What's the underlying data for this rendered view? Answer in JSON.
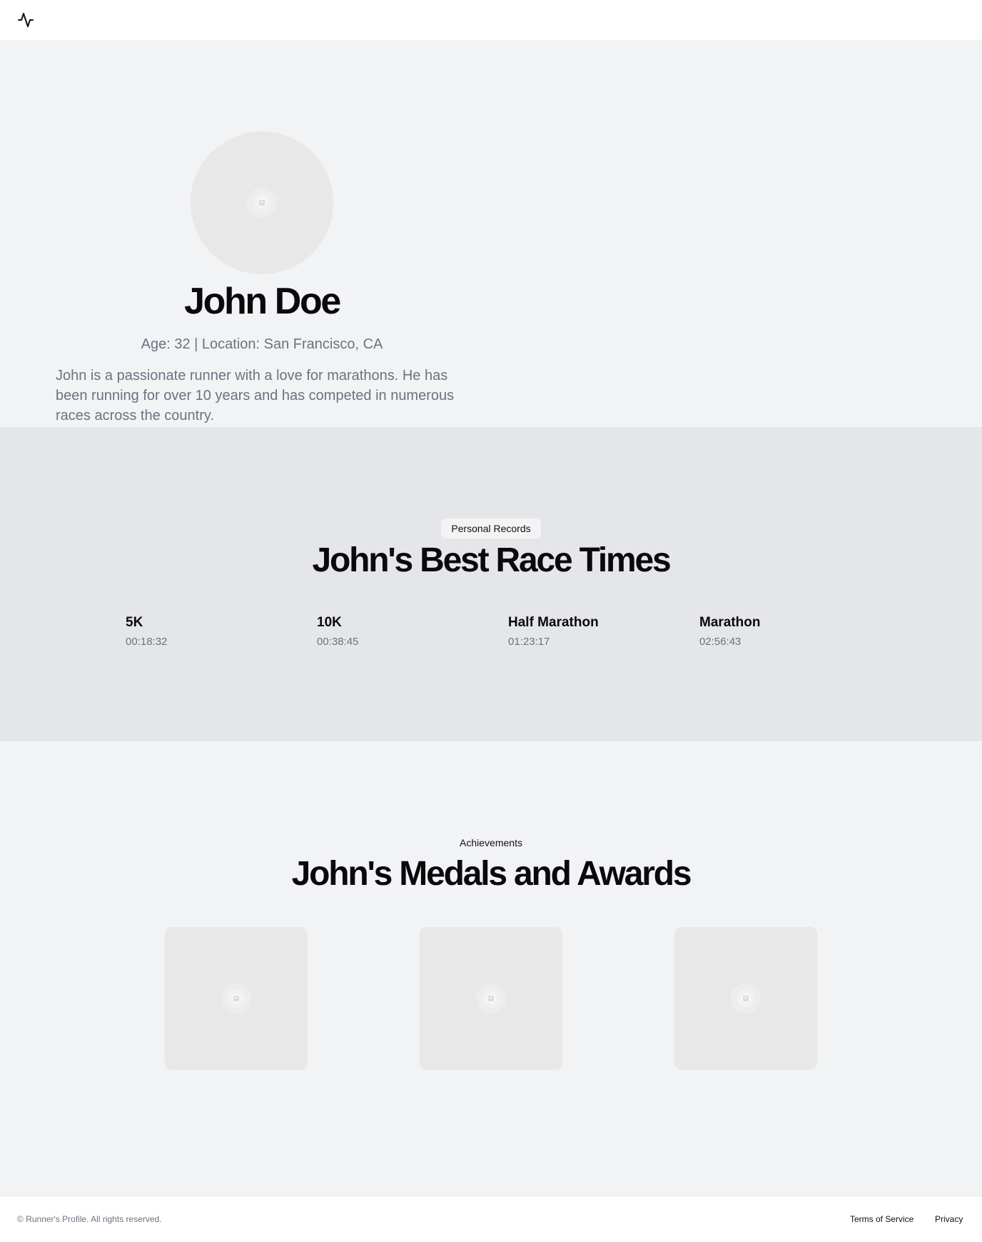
{
  "header": {
    "logo_icon": "activity-pulse-icon"
  },
  "profile": {
    "avatar_icon": "image-placeholder-icon",
    "name": "John Doe",
    "meta": "Age: 32 | Location: San Francisco, CA",
    "bio": "John is a passionate runner with a love for marathons. He has been running for over 10 years and has competed in numerous races across the country."
  },
  "records": {
    "badge": "Personal Records",
    "title": "John's Best Race Times",
    "items": [
      {
        "label": "5K",
        "time": "00:18:32"
      },
      {
        "label": "10K",
        "time": "00:38:45"
      },
      {
        "label": "Half Marathon",
        "time": "01:23:17"
      },
      {
        "label": "Marathon",
        "time": "02:56:43"
      }
    ]
  },
  "achievements": {
    "label": "Achievements",
    "title": "John's Medals and Awards",
    "medal_icon": "image-placeholder-icon"
  },
  "footer": {
    "copyright": "© Runner's Profile. All rights reserved.",
    "terms": "Terms of Service",
    "privacy": "Privacy"
  },
  "colors": {
    "page_bg": "#f2f3f5",
    "section_bg": "#e5e6e9",
    "placeholder_bg": "#e8e8e9",
    "muted_text": "#6b7280"
  }
}
